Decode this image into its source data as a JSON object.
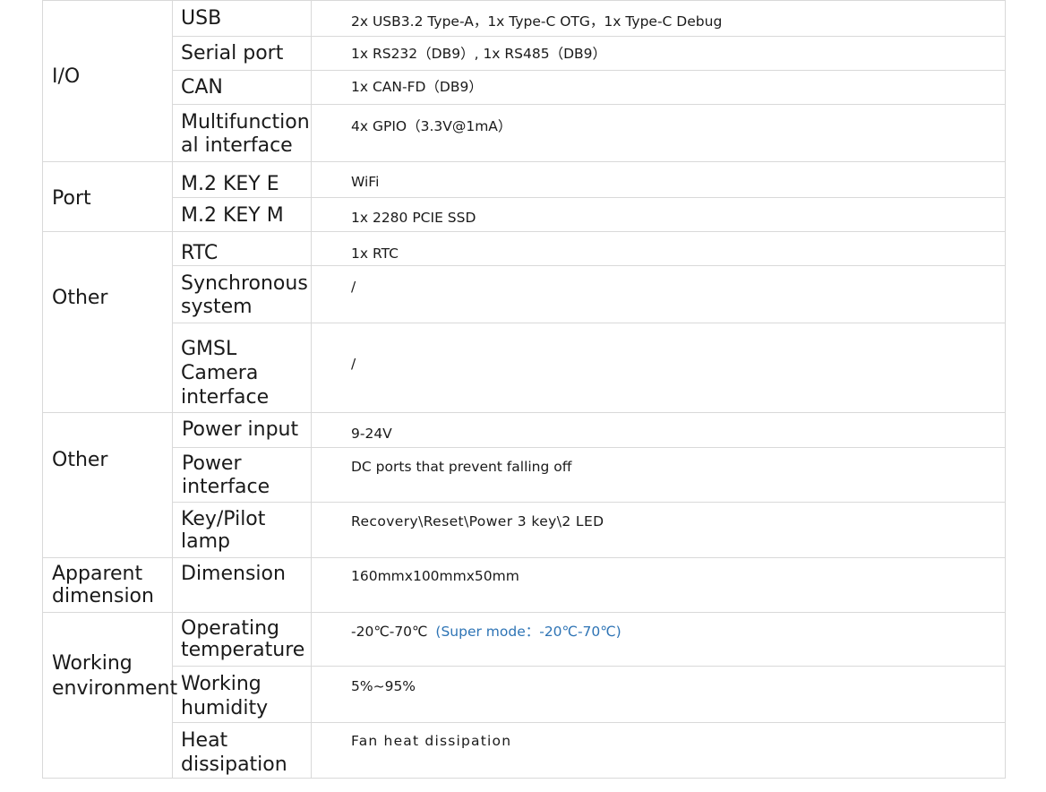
{
  "spec_table": {
    "groups": [
      {
        "category": "I/O",
        "rows": [
          {
            "label": "USB",
            "value": "2x USB3.2 Type-A，1x Type-C OTG，1x Type-C Debug"
          },
          {
            "label": "Serial port",
            "value": "1x RS232（DB9）, 1x RS485（DB9）"
          },
          {
            "label": "CAN",
            "value": "1x CAN-FD（DB9）"
          },
          {
            "label": "Multifunctional interface",
            "value": "4x GPIO（3.3V@1mA）"
          }
        ]
      },
      {
        "category": "Port",
        "rows": [
          {
            "label": "M.2 KEY E",
            "value": "WiFi"
          },
          {
            "label": "M.2 KEY M",
            "value": "1x 2280 PCIE SSD"
          }
        ]
      },
      {
        "category": "Other",
        "rows": [
          {
            "label": "RTC",
            "value": "1x RTC"
          },
          {
            "label": "Synchronous system",
            "value": "/"
          },
          {
            "label": "GMSL Camera interface",
            "value": "/"
          }
        ]
      },
      {
        "category": "Other",
        "rows": [
          {
            "label": "Power input",
            "value": "9-24V"
          },
          {
            "label": "Power interface",
            "value": "DC ports that prevent falling off"
          },
          {
            "label": "Key/Pilot lamp",
            "value": "Recovery\\Reset\\Power  3 key\\2 LED"
          }
        ]
      },
      {
        "category": "Apparent dimension",
        "rows": [
          {
            "label": "Dimension",
            "value": "160mmx100mmx50mm"
          }
        ]
      },
      {
        "category": "Working environment",
        "rows": [
          {
            "label": "Operating temperature",
            "value": "-20℃-70℃",
            "note": "(Super mode：-20℃-70℃)"
          },
          {
            "label": "Working humidity",
            "value": "5%~95%"
          },
          {
            "label": "Heat dissipation",
            "value": "Fan heat dissipation"
          }
        ]
      }
    ]
  },
  "colors": {
    "border": "#d9d9d9",
    "text": "#1a1a1a",
    "accent": "#2e74b5"
  }
}
